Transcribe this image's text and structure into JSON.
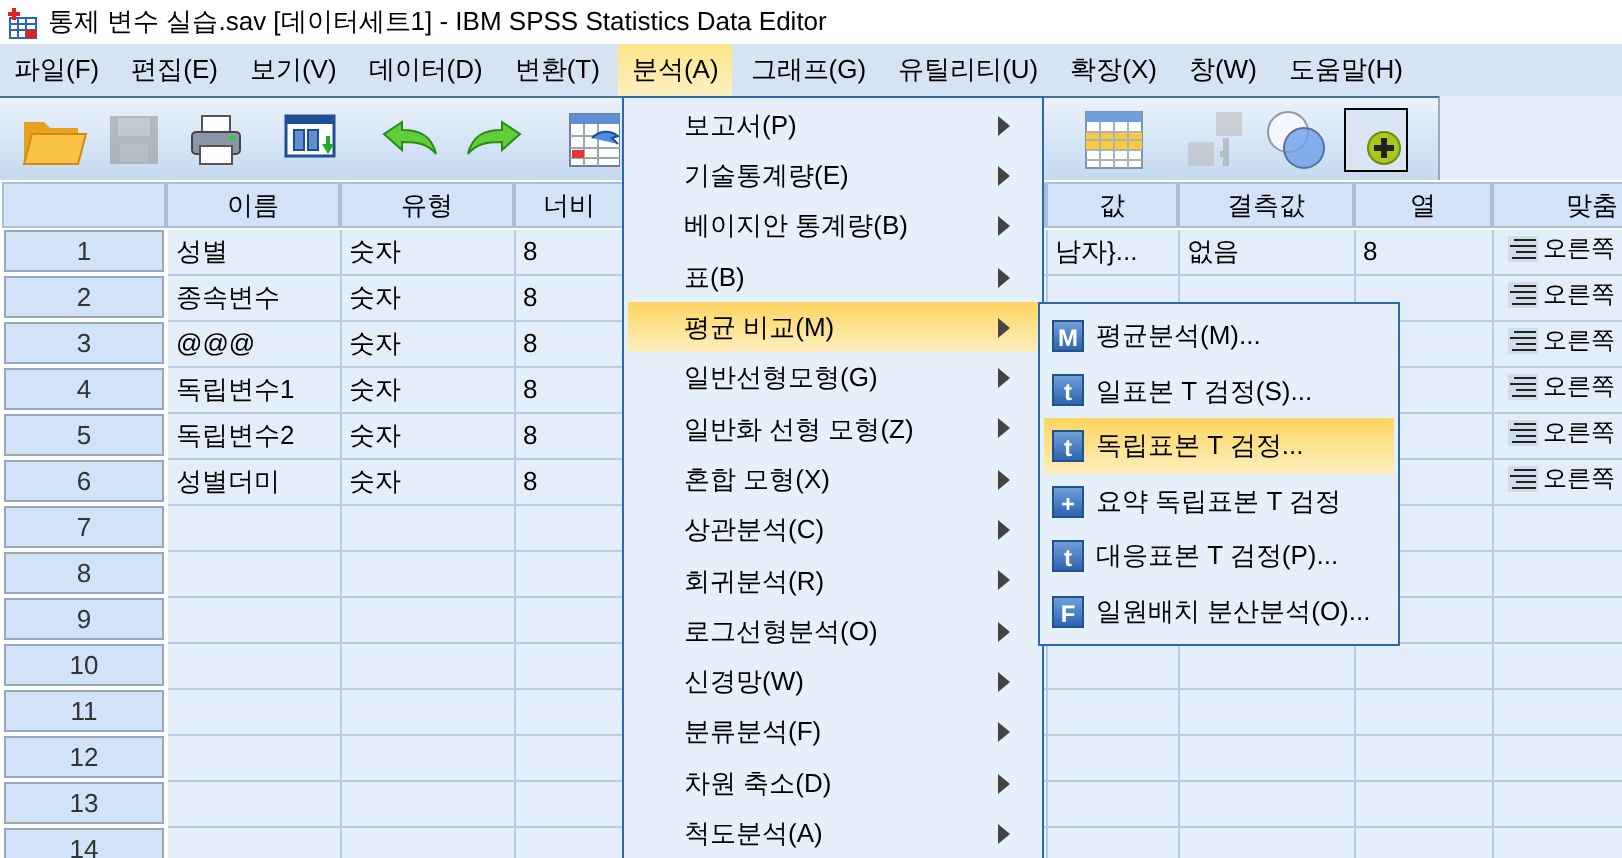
{
  "window": {
    "title": "통제 변수 실습.sav [데이터세트1] - IBM SPSS Statistics Data Editor"
  },
  "menubar": [
    {
      "label": "파일(F)",
      "selected": false
    },
    {
      "label": "편집(E)",
      "selected": false
    },
    {
      "label": "보기(V)",
      "selected": false
    },
    {
      "label": "데이터(D)",
      "selected": false
    },
    {
      "label": "변환(T)",
      "selected": false
    },
    {
      "label": "분석(A)",
      "selected": true
    },
    {
      "label": "그래프(G)",
      "selected": false
    },
    {
      "label": "유틸리티(U)",
      "selected": false
    },
    {
      "label": "확장(X)",
      "selected": false
    },
    {
      "label": "창(W)",
      "selected": false
    },
    {
      "label": "도움말(H)",
      "selected": false
    }
  ],
  "toolbar": [
    {
      "kind": "open",
      "disabled": false
    },
    {
      "kind": "save",
      "disabled": true
    },
    {
      "kind": "print",
      "disabled": false
    },
    {
      "kind": "recall",
      "disabled": false
    },
    {
      "kind": "undo",
      "disabled": false
    },
    {
      "kind": "redo",
      "disabled": false
    },
    {
      "kind": "goto",
      "disabled": false
    },
    {
      "kind": "grid",
      "disabled": false
    },
    {
      "kind": "case",
      "disabled": true
    },
    {
      "kind": "venn",
      "disabled": false
    },
    {
      "kind": "plus",
      "disabled": false
    }
  ],
  "table": {
    "columns": [
      {
        "title": "이름",
        "kind": "text"
      },
      {
        "title": "유형",
        "kind": "text"
      },
      {
        "title": "너비",
        "kind": "text"
      },
      {
        "title": "값",
        "kind": "text"
      },
      {
        "title": "결측값",
        "kind": "text"
      },
      {
        "title": "열",
        "kind": "text"
      },
      {
        "title": "맞춤",
        "kind": "align"
      }
    ],
    "rows": [
      {
        "number": "1",
        "cells": [
          "성별",
          "숫자",
          "8",
          "남자}...",
          "없음",
          "8",
          "오른쪽"
        ]
      },
      {
        "number": "2",
        "cells": [
          "종속변수",
          "숫자",
          "8",
          null,
          null,
          null,
          "오른쪽"
        ]
      },
      {
        "number": "3",
        "cells": [
          "@@@",
          "숫자",
          "8",
          null,
          null,
          null,
          "오른쪽"
        ]
      },
      {
        "number": "4",
        "cells": [
          "독립변수1",
          "숫자",
          "8",
          null,
          null,
          null,
          "오른쪽"
        ]
      },
      {
        "number": "5",
        "cells": [
          "독립변수2",
          "숫자",
          "8",
          null,
          null,
          null,
          "오른쪽"
        ]
      },
      {
        "number": "6",
        "cells": [
          "성별더미",
          "숫자",
          "8",
          null,
          null,
          null,
          "오른쪽"
        ]
      },
      {
        "number": "7",
        "cells": []
      },
      {
        "number": "8",
        "cells": []
      },
      {
        "number": "9",
        "cells": []
      },
      {
        "number": "10",
        "cells": []
      },
      {
        "number": "11",
        "cells": []
      },
      {
        "number": "12",
        "cells": []
      },
      {
        "number": "13",
        "cells": []
      },
      {
        "number": "14",
        "cells": []
      }
    ]
  },
  "menu": {
    "items": [
      {
        "label": "보고서(P)",
        "selected": false
      },
      {
        "label": "기술통계량(E)",
        "selected": false
      },
      {
        "label": "베이지안 통계량(B)",
        "selected": false
      },
      {
        "label": "표(B)",
        "selected": false
      },
      {
        "label": "평균 비교(M)",
        "selected": true
      },
      {
        "label": "일반선형모형(G)",
        "selected": false
      },
      {
        "label": "일반화 선형 모형(Z)",
        "selected": false
      },
      {
        "label": "혼합 모형(X)",
        "selected": false
      },
      {
        "label": "상관분석(C)",
        "selected": false
      },
      {
        "label": "회귀분석(R)",
        "selected": false
      },
      {
        "label": "로그선형분석(O)",
        "selected": false
      },
      {
        "label": "신경망(W)",
        "selected": false
      },
      {
        "label": "분류분석(F)",
        "selected": false
      },
      {
        "label": "차원 축소(D)",
        "selected": false
      },
      {
        "label": "척도분석(A)",
        "selected": false
      }
    ]
  },
  "submenu": {
    "items": [
      {
        "label": "평균분석(M)...",
        "icon_text": "M",
        "selected": false
      },
      {
        "label": "일표본 T 검정(S)...",
        "icon_text": "t",
        "selected": false
      },
      {
        "label": "독립표본 T 검정...",
        "icon_text": "t",
        "selected": true
      },
      {
        "label": "요약 독립표본 T 검정",
        "icon_text": "+",
        "selected": false
      },
      {
        "label": "대응표본 T 검정(P)...",
        "icon_text": "t",
        "selected": false
      },
      {
        "label": "일원배치 분산분석(O)...",
        "icon_text": "F",
        "selected": false
      }
    ]
  }
}
